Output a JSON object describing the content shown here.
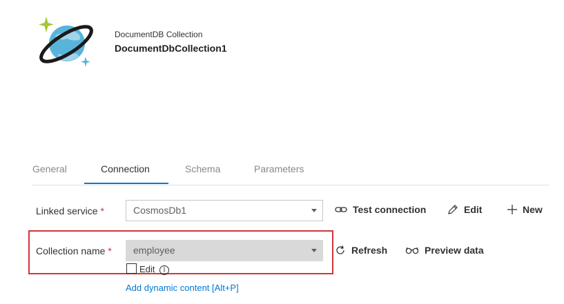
{
  "header": {
    "type_label": "DocumentDB Collection",
    "title": "DocumentDbCollection1",
    "icon": "cosmos-db-logo-icon"
  },
  "tabs": [
    {
      "label": "General",
      "active": false
    },
    {
      "label": "Connection",
      "active": true
    },
    {
      "label": "Schema",
      "active": false
    },
    {
      "label": "Parameters",
      "active": false
    }
  ],
  "linked_service": {
    "label": "Linked service",
    "required_mark": "*",
    "value": "CosmosDb1",
    "test_connection_label": "Test connection",
    "edit_label": "Edit",
    "new_label": "New"
  },
  "collection": {
    "label": "Collection name",
    "required_mark": "*",
    "value": "employee",
    "refresh_label": "Refresh",
    "preview_label": "Preview data",
    "edit_checkbox_label": "Edit",
    "edit_checked": false,
    "info_glyph": "i",
    "dynamic_content_link": "Add dynamic content [Alt+P]"
  },
  "colors": {
    "accent": "#0078d4",
    "highlight_border": "#d13438",
    "required": "#c4314b"
  }
}
